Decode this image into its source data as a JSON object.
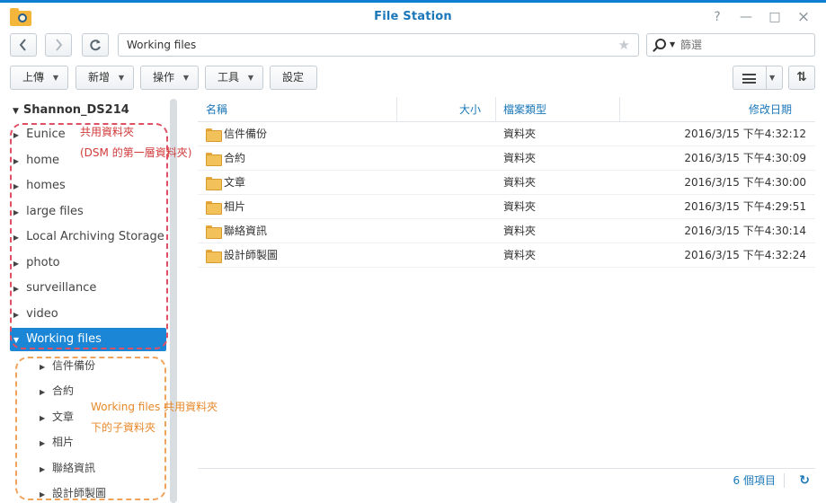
{
  "window": {
    "title": "File Station",
    "controls": {
      "help": "?",
      "minimize": "—",
      "maximize": "□",
      "close": "×"
    }
  },
  "nav": {
    "back_icon": "chevron-left-icon",
    "forward_icon": "chevron-right-icon",
    "refresh_icon": "refresh-icon",
    "path": "Working files",
    "search_placeholder": "篩選"
  },
  "toolbar": {
    "upload": "上傳",
    "create": "新增",
    "action": "操作",
    "tools": "工具",
    "settings": "設定"
  },
  "tree": {
    "root": "Shannon_DS214",
    "items": [
      {
        "label": "Eunice"
      },
      {
        "label": "home"
      },
      {
        "label": "homes"
      },
      {
        "label": "large files"
      },
      {
        "label": "Local Archiving Storage"
      },
      {
        "label": "photo"
      },
      {
        "label": "surveillance"
      },
      {
        "label": "video"
      },
      {
        "label": "Working files",
        "selected": true
      }
    ],
    "subitems": [
      {
        "label": "信件備份"
      },
      {
        "label": "合約"
      },
      {
        "label": "文章"
      },
      {
        "label": "相片"
      },
      {
        "label": "聯絡資訊"
      },
      {
        "label": "設計師製圖"
      }
    ]
  },
  "annotations": {
    "red_line1": "共用資料夾",
    "red_line2": "(DSM 的第一層資料夾)",
    "orange_line1": "Working files 共用資料夾",
    "orange_line2": "下的子資料夾"
  },
  "list": {
    "headers": {
      "name": "名稱",
      "size": "大小",
      "type": "檔案類型",
      "modified": "修改日期"
    },
    "rows": [
      {
        "name": "信件備份",
        "type": "資料夾",
        "modified": "2016/3/15 下午4:32:12"
      },
      {
        "name": "合約",
        "type": "資料夾",
        "modified": "2016/3/15 下午4:30:09"
      },
      {
        "name": "文章",
        "type": "資料夾",
        "modified": "2016/3/15 下午4:30:00"
      },
      {
        "name": "相片",
        "type": "資料夾",
        "modified": "2016/3/15 下午4:29:51"
      },
      {
        "name": "聯絡資訊",
        "type": "資料夾",
        "modified": "2016/3/15 下午4:30:14"
      },
      {
        "name": "設計師製圖",
        "type": "資料夾",
        "modified": "2016/3/15 下午4:32:24"
      }
    ]
  },
  "status": {
    "count": "6 個項目"
  },
  "colors": {
    "accent": "#1a86d5",
    "title": "#1b77b9",
    "annotation_red": "#e05065",
    "annotation_orange": "#f0a35a"
  }
}
